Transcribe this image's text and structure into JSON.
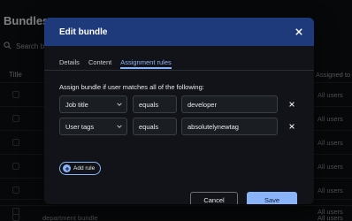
{
  "background": {
    "page_title": "Bundles",
    "search_placeholder": "Search b",
    "columns": {
      "title": "Title",
      "assigned_to": "Assigned to"
    },
    "rows": [
      {
        "name": "",
        "assigned": "All users"
      },
      {
        "name": "",
        "assigned": "All users"
      },
      {
        "name": "",
        "assigned": "All users"
      },
      {
        "name": "",
        "assigned": "All users"
      },
      {
        "name": "",
        "assigned": "All users"
      },
      {
        "name": "",
        "assigned": "All users"
      },
      {
        "name": "department bundle",
        "assigned": "All users"
      }
    ]
  },
  "modal": {
    "title": "Edit bundle",
    "tabs": [
      {
        "label": "Details",
        "active": false
      },
      {
        "label": "Content",
        "active": false
      },
      {
        "label": "Assignment rules",
        "active": true
      }
    ],
    "rule_heading": "Assign bundle if user matches all of the following:",
    "rules": [
      {
        "attribute": "Job title",
        "operator": "equals",
        "value": "developer"
      },
      {
        "attribute": "User tags",
        "operator": "equals",
        "value": "absolutelynewtag"
      }
    ],
    "add_rule_label": "Add rule",
    "cancel_label": "Cancel",
    "save_label": "Save"
  },
  "colors": {
    "header_bg": "#1f3a7a",
    "accent": "#8ab4f8",
    "modal_bg": "#111318",
    "page_bg": "#0d0f12"
  },
  "icons": {
    "close": "close-icon",
    "search": "search-icon",
    "dropdown": "chevron-down-icon",
    "remove": "close-icon",
    "add": "plus-icon"
  }
}
